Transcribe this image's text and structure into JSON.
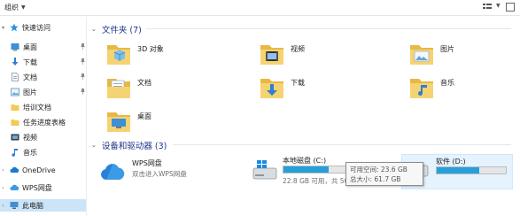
{
  "toolbar": {
    "organize_label": "组织",
    "view_icon": "view-options-icon",
    "help_icon": "help-icon"
  },
  "nav": {
    "quick_access": "快速访问",
    "items": [
      {
        "label": "桌面",
        "icon": "desktop-icon",
        "pinned": true
      },
      {
        "label": "下载",
        "icon": "download-icon",
        "pinned": true
      },
      {
        "label": "文档",
        "icon": "document-icon",
        "pinned": true
      },
      {
        "label": "图片",
        "icon": "picture-icon",
        "pinned": true
      },
      {
        "label": "培训文档",
        "icon": "folder-icon",
        "pinned": false
      },
      {
        "label": "任务进度表格",
        "icon": "folder-icon",
        "pinned": false
      },
      {
        "label": "视频",
        "icon": "video-icon",
        "pinned": false
      },
      {
        "label": "音乐",
        "icon": "music-icon",
        "pinned": false
      }
    ],
    "onedrive": "OneDrive",
    "wps": "WPS网盘",
    "this_pc": "此电脑"
  },
  "folders_group": {
    "title": "文件夹 (7)",
    "items": [
      {
        "label": "3D 对象",
        "icon": "3d-objects-folder-icon"
      },
      {
        "label": "视频",
        "icon": "videos-folder-icon"
      },
      {
        "label": "图片",
        "icon": "pictures-folder-icon"
      },
      {
        "label": "文档",
        "icon": "documents-folder-icon"
      },
      {
        "label": "下载",
        "icon": "downloads-folder-icon"
      },
      {
        "label": "音乐",
        "icon": "music-folder-icon"
      },
      {
        "label": "桌面",
        "icon": "desktop-folder-icon"
      }
    ]
  },
  "devices_group": {
    "title": "设备和驱动器 (3)",
    "wps": {
      "name": "WPS网盘",
      "subtitle": "双击进入WPS网盘"
    },
    "drives": [
      {
        "name": "本地磁盘 (C:)",
        "info": "22.8 GB 可用，共 50.0 GB",
        "used_fraction": 0.544
      },
      {
        "name": "软件 (D:)",
        "info": "",
        "used_fraction": 0.617
      }
    ],
    "tooltip": {
      "free": "可用空间: 23.6 GB",
      "total": "总大小: 61.7 GB"
    }
  },
  "colors": {
    "accent": "#26a0da",
    "group_title": "#1e3287",
    "selection": "#cce4f7",
    "hover": "#e5f3ff"
  }
}
